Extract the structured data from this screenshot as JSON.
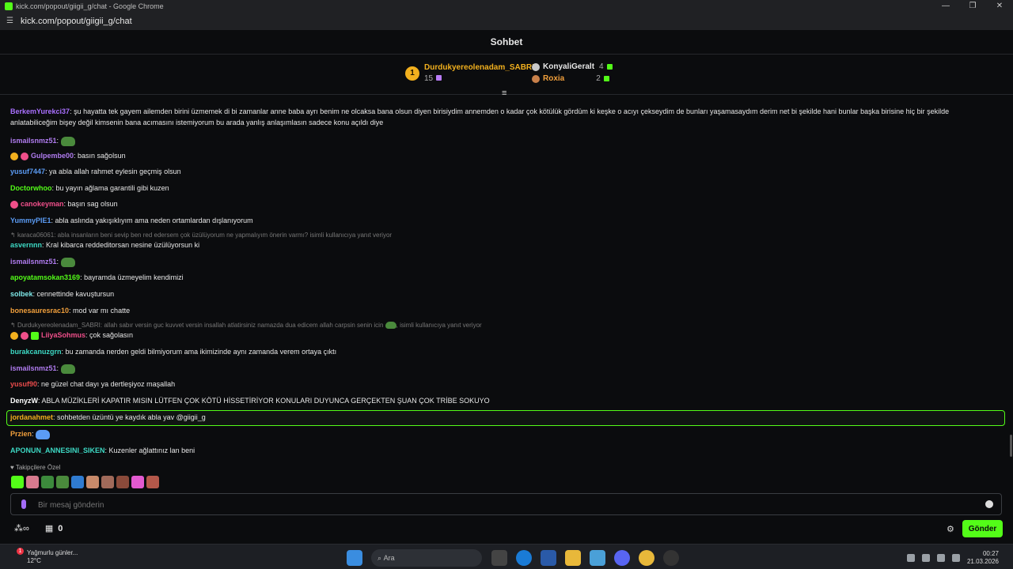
{
  "window": {
    "title": "kick.com/popout/giigii_g/chat - Google Chrome",
    "url": "kick.com/popout/giigii_g/chat"
  },
  "header": {
    "title": "Sohbet"
  },
  "leaderboard": {
    "first": {
      "rank": "1",
      "name": "Durdukyereolenadam_SABRI",
      "count": "15"
    },
    "second": {
      "name": "KonyaliGeralt",
      "count": "4"
    },
    "third": {
      "name": "Roxia",
      "count": "2"
    }
  },
  "messages": [
    {
      "user": "BerkemYurekci37",
      "color": "#a970ff",
      "text": ": şu hayatta tek gayem ailemden birini üzmemek di bi zamanlar anne baba ayrı benim ne olcaksa bana olsun diyen birisiydim annemden o kadar çok kötülük gördüm ki keşke o acıyı çekseydim de bunları yaşamasaydım derim net bi şekilde hani bunlar başka birisine hiç bir şekilde anlatabiliceğim bişey değil kimsenin bana acımasını istemiyorum bu arada yanlış anlaşımlasın sadece konu açıldı diye"
    },
    {
      "user": "ismailsnmz51",
      "color": "#b07cf0",
      "text": ":"
    },
    {
      "user": "Gulpembe00",
      "color": "#b07cf0",
      "text": ": basın sağolsun"
    },
    {
      "user": "yusuf7447",
      "color": "#5b9cf5",
      "text": ": ya abla allah rahmet eylesin geçmiş olsun"
    },
    {
      "user": "Doctorwhoo",
      "color": "#53fc18",
      "text": ": bu yayın ağlama garantili gibi kuzen"
    },
    {
      "user": "canokeyman",
      "color": "#ef4f8a",
      "text": ": başın sag olsun"
    },
    {
      "user": "YummyPIE1",
      "color": "#5b9cf5",
      "text": ": abla aslında yakışıklıyım ama neden ortamlardan dışlanıyorum"
    },
    {
      "reply": "karaca06061: abla insanların beni sevip ben red edersem çok üzülüyorum ne yapmalıyım önerin varmı? isimli kullanıcıya yanıt veriyor"
    },
    {
      "user": "asvernnn",
      "color": "#3dd9c4",
      "text": ": Kral kibarca reddeditorsan nesine üzülüyorsun ki"
    },
    {
      "user": "ismailsnmz51",
      "color": "#b07cf0",
      "text": ":"
    },
    {
      "user": "apoyatamsokan3169",
      "color": "#53fc18",
      "text": ": bayramda üzmeyelim kendimizi"
    },
    {
      "user": "solbek",
      "color": "#7ee7e7",
      "text": ": cennettinde kavuştursun"
    },
    {
      "user": "bonesauresrac10",
      "color": "#f2a03c",
      "text": ": mod var mı chatte"
    },
    {
      "reply": "Durdukyereolenadam_SABRI: allah sabır versin guc kuvvet versin insallah atlatirsiniz namazda dua edicem allah carpsin senin icin",
      "reply_tail": "isimli kullanıcıya yanıt veriyor"
    },
    {
      "user": "LiiyaSohmus",
      "color": "#ef4f8a",
      "text": ": çok sağolasın"
    },
    {
      "user": "burakcanuzgrn",
      "color": "#3dd9c4",
      "text": ": bu zamanda nerden geldi bilmiyorum ama ikimizinde aynı zamanda verem ortaya çıktı"
    },
    {
      "user": "ismailsnmz51",
      "color": "#b07cf0",
      "text": ":"
    },
    {
      "user": "yusuf90",
      "color": "#e94b4b",
      "text": ": ne güzel chat dayı ya dertleşiyoz maşallah"
    },
    {
      "user": "DenyzW",
      "color": "#ffffff",
      "text": ": ABLA MÜZİKLERİ KAPATIR MISIN LÜTFEN ÇOK KÖTÜ HİSSETİRİYOR KONULARI DUYUNCA GERÇEKTEN ŞUAN ÇOK TRİBE SOKUYO"
    },
    {
      "user": "jordanahmet",
      "color": "#f2b01e",
      "text": ": sohbetden üzüntü ye kaydık abla yav @giigii_g"
    },
    {
      "user": "Przien",
      "color": "#f2a03c",
      "text": ":"
    },
    {
      "user": "APONUN_ANNESINI_SIKEN",
      "color": "#3dd9c4",
      "text": ": Kuzenler ağlattınız lan beni"
    }
  ],
  "followers_label": "Takipçilere Özel",
  "input": {
    "placeholder": "Bir mesaj gönderin"
  },
  "bottom": {
    "points": "0",
    "send_label": "Gönder"
  },
  "taskbar": {
    "weather_title": "Yağmurlu günler...",
    "weather_temp": "12°C",
    "weather_badge": "1",
    "search_label": "Ara",
    "time": "00:27",
    "date": "21.03.2026"
  },
  "colors": {
    "accent": "#53fc18",
    "background": "#0b0c0e"
  }
}
